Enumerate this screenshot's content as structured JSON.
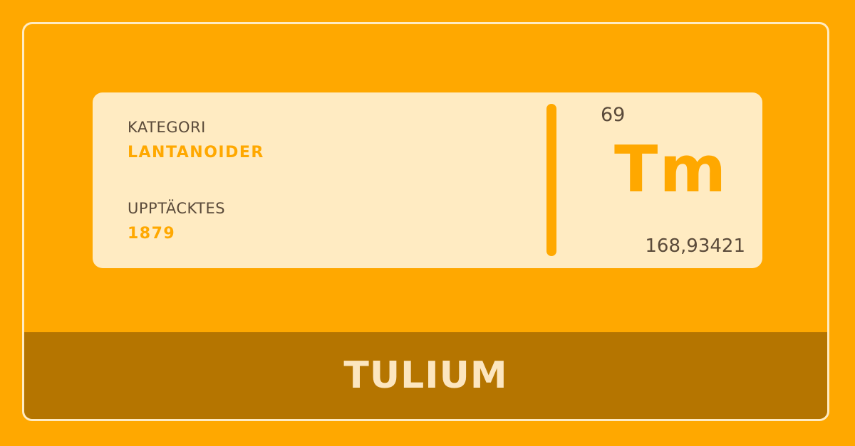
{
  "element": {
    "name": "TULIUM",
    "symbol": "Tm",
    "atomic_number": "69",
    "atomic_mass": "168,93421"
  },
  "fields": {
    "category_label": "KATEGORI",
    "category_value": "LANTANOIDER",
    "discovered_label": "UPPTÄCKTES",
    "discovered_value": "1879"
  },
  "colors": {
    "background": "#FFA800",
    "card": "#FFEBC2",
    "footer": "#B57500",
    "accent": "#FFA800",
    "text_dark": "#5A4A3A",
    "footer_text": "#FCE6BF"
  }
}
